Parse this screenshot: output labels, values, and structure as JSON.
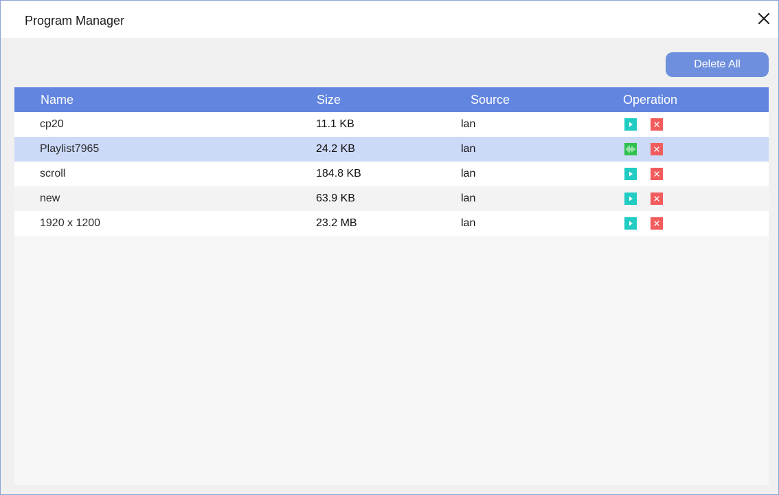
{
  "window": {
    "title": "Program Manager"
  },
  "toolbar": {
    "delete_all_label": "Delete All"
  },
  "table": {
    "columns": [
      "Name",
      "Size",
      "Source",
      "Operation"
    ],
    "rows": [
      {
        "name": "cp20",
        "size": "11.1 KB",
        "source": "lan",
        "state": "idle"
      },
      {
        "name": "Playlist7965",
        "size": "24.2 KB",
        "source": "lan",
        "state": "playing"
      },
      {
        "name": "scroll",
        "size": "184.8 KB",
        "source": "lan",
        "state": "idle"
      },
      {
        "name": "new",
        "size": "63.9 KB",
        "source": "lan",
        "state": "idle"
      },
      {
        "name": "1920 x 1200",
        "size": "23.2 MB",
        "source": "lan",
        "state": "idle"
      }
    ]
  },
  "colors": {
    "header": "#6285e0",
    "button": "#6e8fdd",
    "row_selected": "#ccd9f7",
    "row_odd": "#ffffff",
    "row_even": "#f3f3f3",
    "play": "#21ccc3",
    "delete": "#f25c5c",
    "playing": "#2fc14d"
  },
  "icons": {
    "close": "close-icon",
    "play": "play-icon",
    "delete": "delete-icon",
    "playing": "audio-wave-icon"
  }
}
